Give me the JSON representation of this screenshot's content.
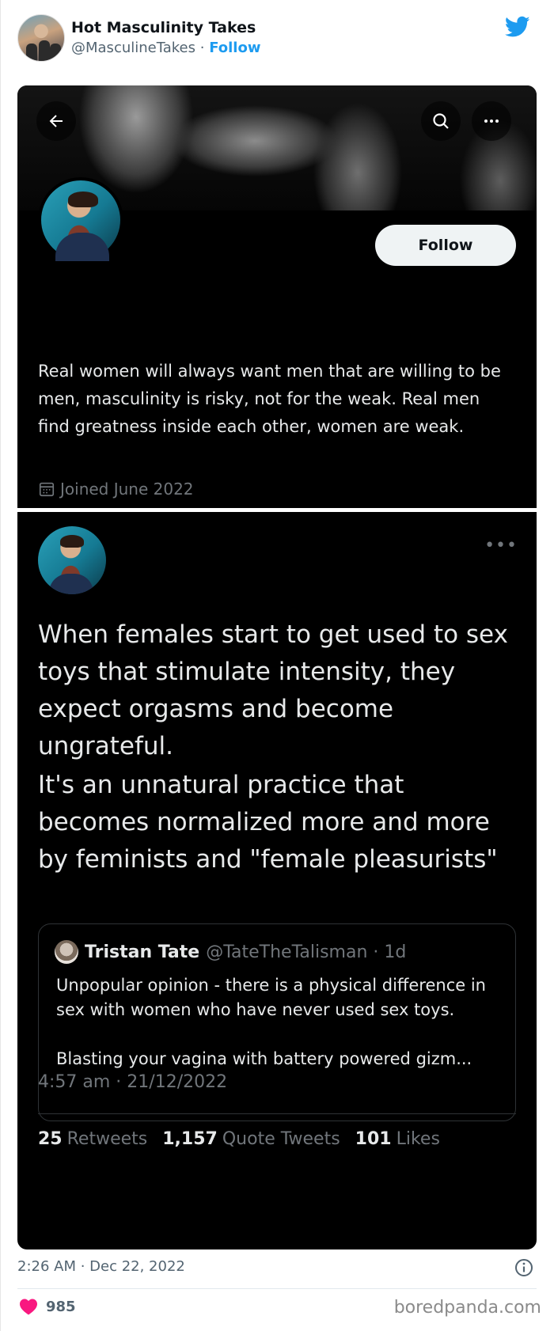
{
  "embed": {
    "account_name": "Hot Masculinity Takes",
    "handle": "@MasculineTakes",
    "separator": " · ",
    "follow_label": "Follow",
    "post_time": "2:26 AM · Dec 22, 2022",
    "like_count": "985",
    "watermark": "boredpanda.com",
    "accent_color": "#1d9bf0",
    "like_color": "#f91880"
  },
  "profile": {
    "follow_button": "Follow",
    "bio": "Real women will always want men that are willing to be men, masculinity is risky, not for the weak. Real men find greatness inside each other, women are weak.",
    "joined": "Joined June 2022"
  },
  "tweet": {
    "paragraph1": "When females start to get used to sex toys that stimulate intensity, they expect orgasms and become ungrateful.",
    "paragraph2": "It's an unnatural practice that becomes normalized more and more by feminists and \"female pleasurists\"",
    "quote": {
      "name": "Tristan Tate",
      "handle": "@TateTheTalisman · 1d",
      "para1": "Unpopular opinion - there is a physical difference in sex with women who have never used sex toys.",
      "para2": "Blasting your vagina with battery powered gizm..."
    },
    "timestamp": "4:57 am · 21/12/2022",
    "stats": {
      "retweets": "25",
      "retweets_label": "Retweets",
      "quotes": "1,157",
      "quotes_label": "Quote Tweets",
      "likes": "101",
      "likes_label": "Likes"
    }
  }
}
